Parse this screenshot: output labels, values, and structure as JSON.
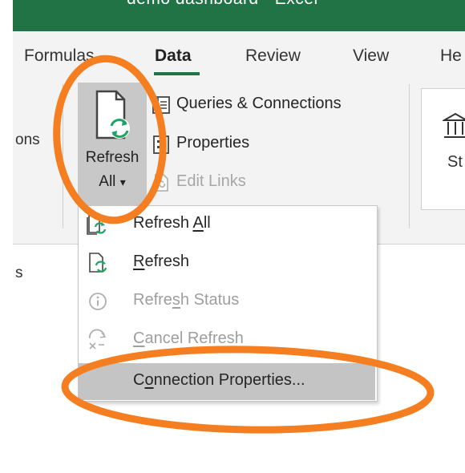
{
  "window": {
    "title": "demo dashboard  -  Excel",
    "accent": "#217346"
  },
  "ribbon": {
    "tabs": [
      "Formulas",
      "Data",
      "Review",
      "View",
      "He"
    ],
    "active_tab": "Data",
    "partial_left_label": "ons",
    "refresh_all": {
      "line1": "Refresh",
      "line2": "All",
      "caret": "▾",
      "icon": "refresh-document-icon"
    },
    "small_buttons": [
      {
        "label": "Queries & Connections",
        "icon": "queries-connections-icon",
        "enabled": true
      },
      {
        "label": "Properties",
        "icon": "properties-icon",
        "enabled": true
      },
      {
        "label": "Edit Links",
        "icon": "edit-links-icon",
        "enabled": false
      }
    ],
    "stocks_partial_label": "St"
  },
  "sheet": {
    "partial_label": "s"
  },
  "dropdown": {
    "items": [
      {
        "pre": "Refresh ",
        "u": "A",
        "post": "ll",
        "icon": "refresh-all-icon",
        "enabled": true
      },
      {
        "pre": "",
        "u": "R",
        "post": "efresh",
        "icon": "refresh-icon",
        "enabled": true
      },
      {
        "pre": "Refre",
        "u": "s",
        "post": "h Status",
        "icon": "info-icon",
        "enabled": false
      },
      {
        "pre": "",
        "u": "C",
        "post": "ancel Refresh",
        "icon": "cancel-refresh-icon",
        "enabled": false
      },
      {
        "pre": "C",
        "u": "o",
        "post": "nnection Properties...",
        "icon": "none",
        "enabled": true,
        "highlighted": true
      }
    ]
  },
  "annotation": {
    "color": "#f47e20"
  }
}
